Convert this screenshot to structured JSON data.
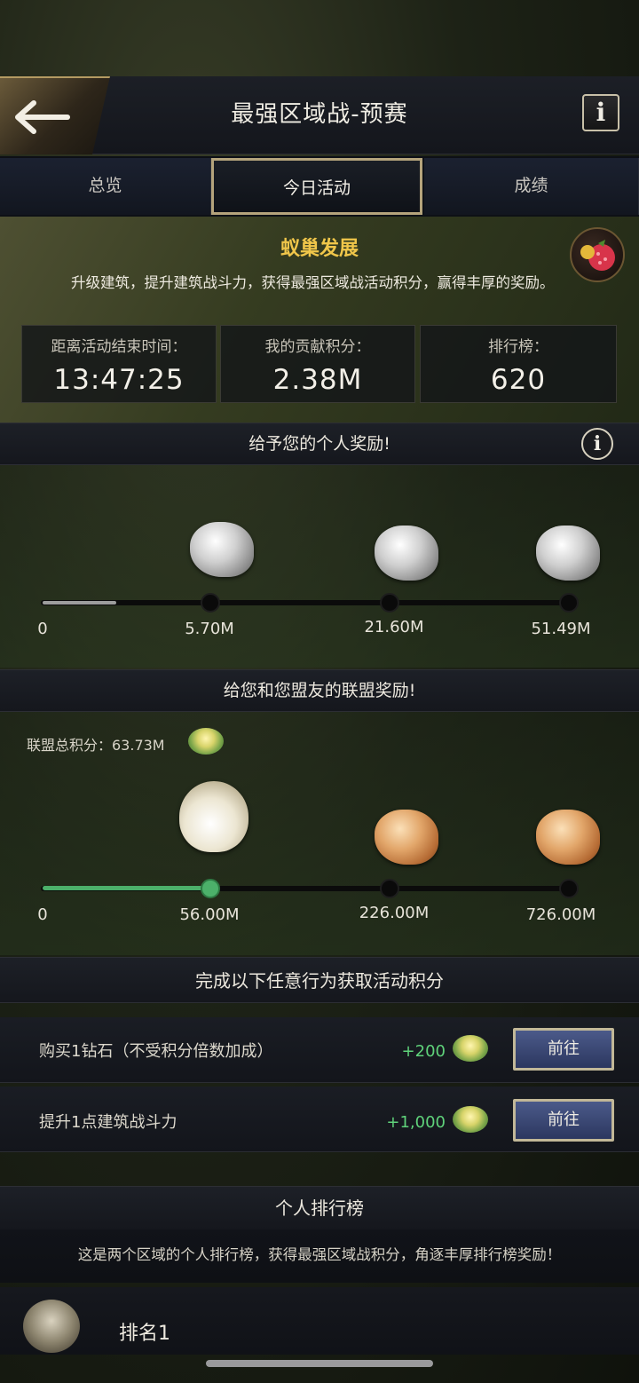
{
  "header": {
    "title": "最强区域战-预赛",
    "back_icon": "arrow-left-icon",
    "info_label": "i"
  },
  "tabs": [
    {
      "label": "总览",
      "active": false
    },
    {
      "label": "今日活动",
      "active": true
    },
    {
      "label": "成绩",
      "active": false
    }
  ],
  "event": {
    "title": "蚁巢发展",
    "description": "升级建筑，提升建筑战斗力，获得最强区域战活动积分，赢得丰厚的奖励。",
    "stats": [
      {
        "label": "距离活动结束时间：",
        "value": "13:47:25"
      },
      {
        "label": "我的贡献积分：",
        "value": "2.38M"
      },
      {
        "label": "排行榜：",
        "value": "620"
      }
    ]
  },
  "personal_rewards": {
    "title": "给予您的个人奖励!",
    "info_label": "i",
    "progress": 0.05,
    "milestones": [
      "0",
      "5.70M",
      "21.60M",
      "51.49M"
    ]
  },
  "alliance_rewards": {
    "title": "给您和您盟友的联盟奖励!",
    "total_label": "联盟总积分：63.73M",
    "progress": 0.28,
    "milestones": [
      "0",
      "56.00M",
      "226.00M",
      "726.00M"
    ]
  },
  "tasks": {
    "title": "完成以下任意行为获取活动积分",
    "items": [
      {
        "label": "购买1钻石（不受积分倍数加成）",
        "points": "+200",
        "button": "前往"
      },
      {
        "label": "提升1点建筑战斗力",
        "points": "+1,000",
        "button": "前往"
      }
    ]
  },
  "ranking": {
    "title": "个人排行榜",
    "description": "这是两个区域的个人排行榜，获得最强区域战积分，角逐丰厚排行榜奖励！",
    "first_row": "排名1"
  },
  "colors": {
    "gold": "#f0c64a",
    "green": "#4cb06a",
    "points_green": "#5fd27a",
    "button_blue": "#3a4876"
  }
}
